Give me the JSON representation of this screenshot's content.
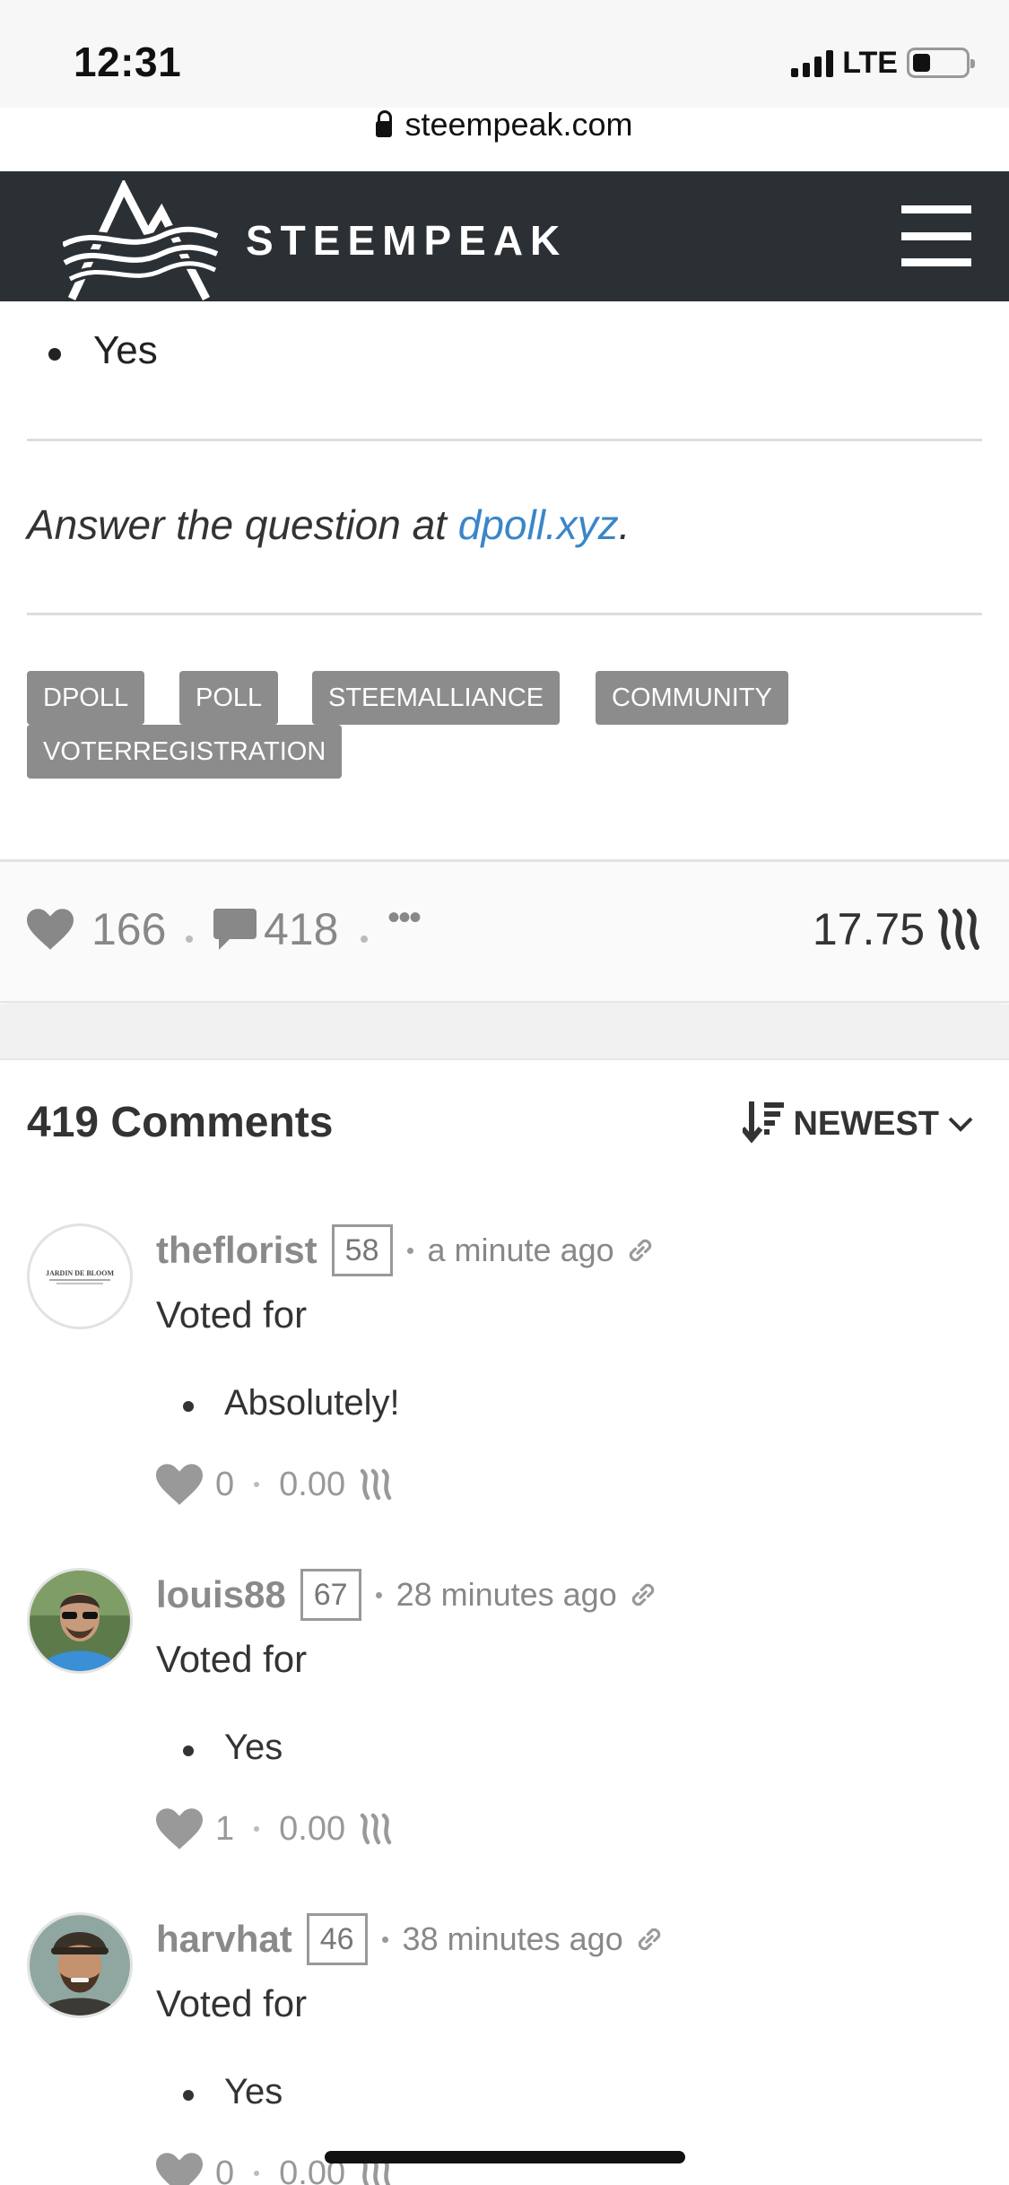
{
  "status_bar": {
    "time": "12:31",
    "network": "LTE",
    "url": "steempeak.com"
  },
  "header": {
    "brand": "STEEMPEAK"
  },
  "post": {
    "bullet": "Yes",
    "answer_prefix": "Answer the question at ",
    "answer_link": "dpoll.xyz",
    "answer_suffix": ".",
    "tags": [
      "DPOLL",
      "POLL",
      "STEEMALLIANCE",
      "COMMUNITY",
      "VOTERREGISTRATION"
    ]
  },
  "actions": {
    "votes": "166",
    "comments": "418",
    "more": "•••",
    "payout": "17.75"
  },
  "comments_section": {
    "title": "419 Comments",
    "sort_label": "NEWEST",
    "items": [
      {
        "author": "theflorist",
        "rep": "58",
        "time": "a minute ago",
        "text": "Voted for",
        "bullet": "Absolutely!",
        "votes": "0",
        "payout": "0.00",
        "avatar_text": "JARDIN DE BLOOM"
      },
      {
        "author": "louis88",
        "rep": "67",
        "time": "28 minutes ago",
        "text": "Voted for",
        "bullet": "Yes",
        "votes": "1",
        "payout": "0.00"
      },
      {
        "author": "harvhat",
        "rep": "46",
        "time": "38 minutes ago",
        "text": "Voted for",
        "bullet": "Yes",
        "votes": "0",
        "payout": "0.00"
      }
    ]
  },
  "colors": {
    "header_bg": "#2b3035",
    "link": "#3a86c8",
    "tag_bg": "#8c8c8c"
  }
}
